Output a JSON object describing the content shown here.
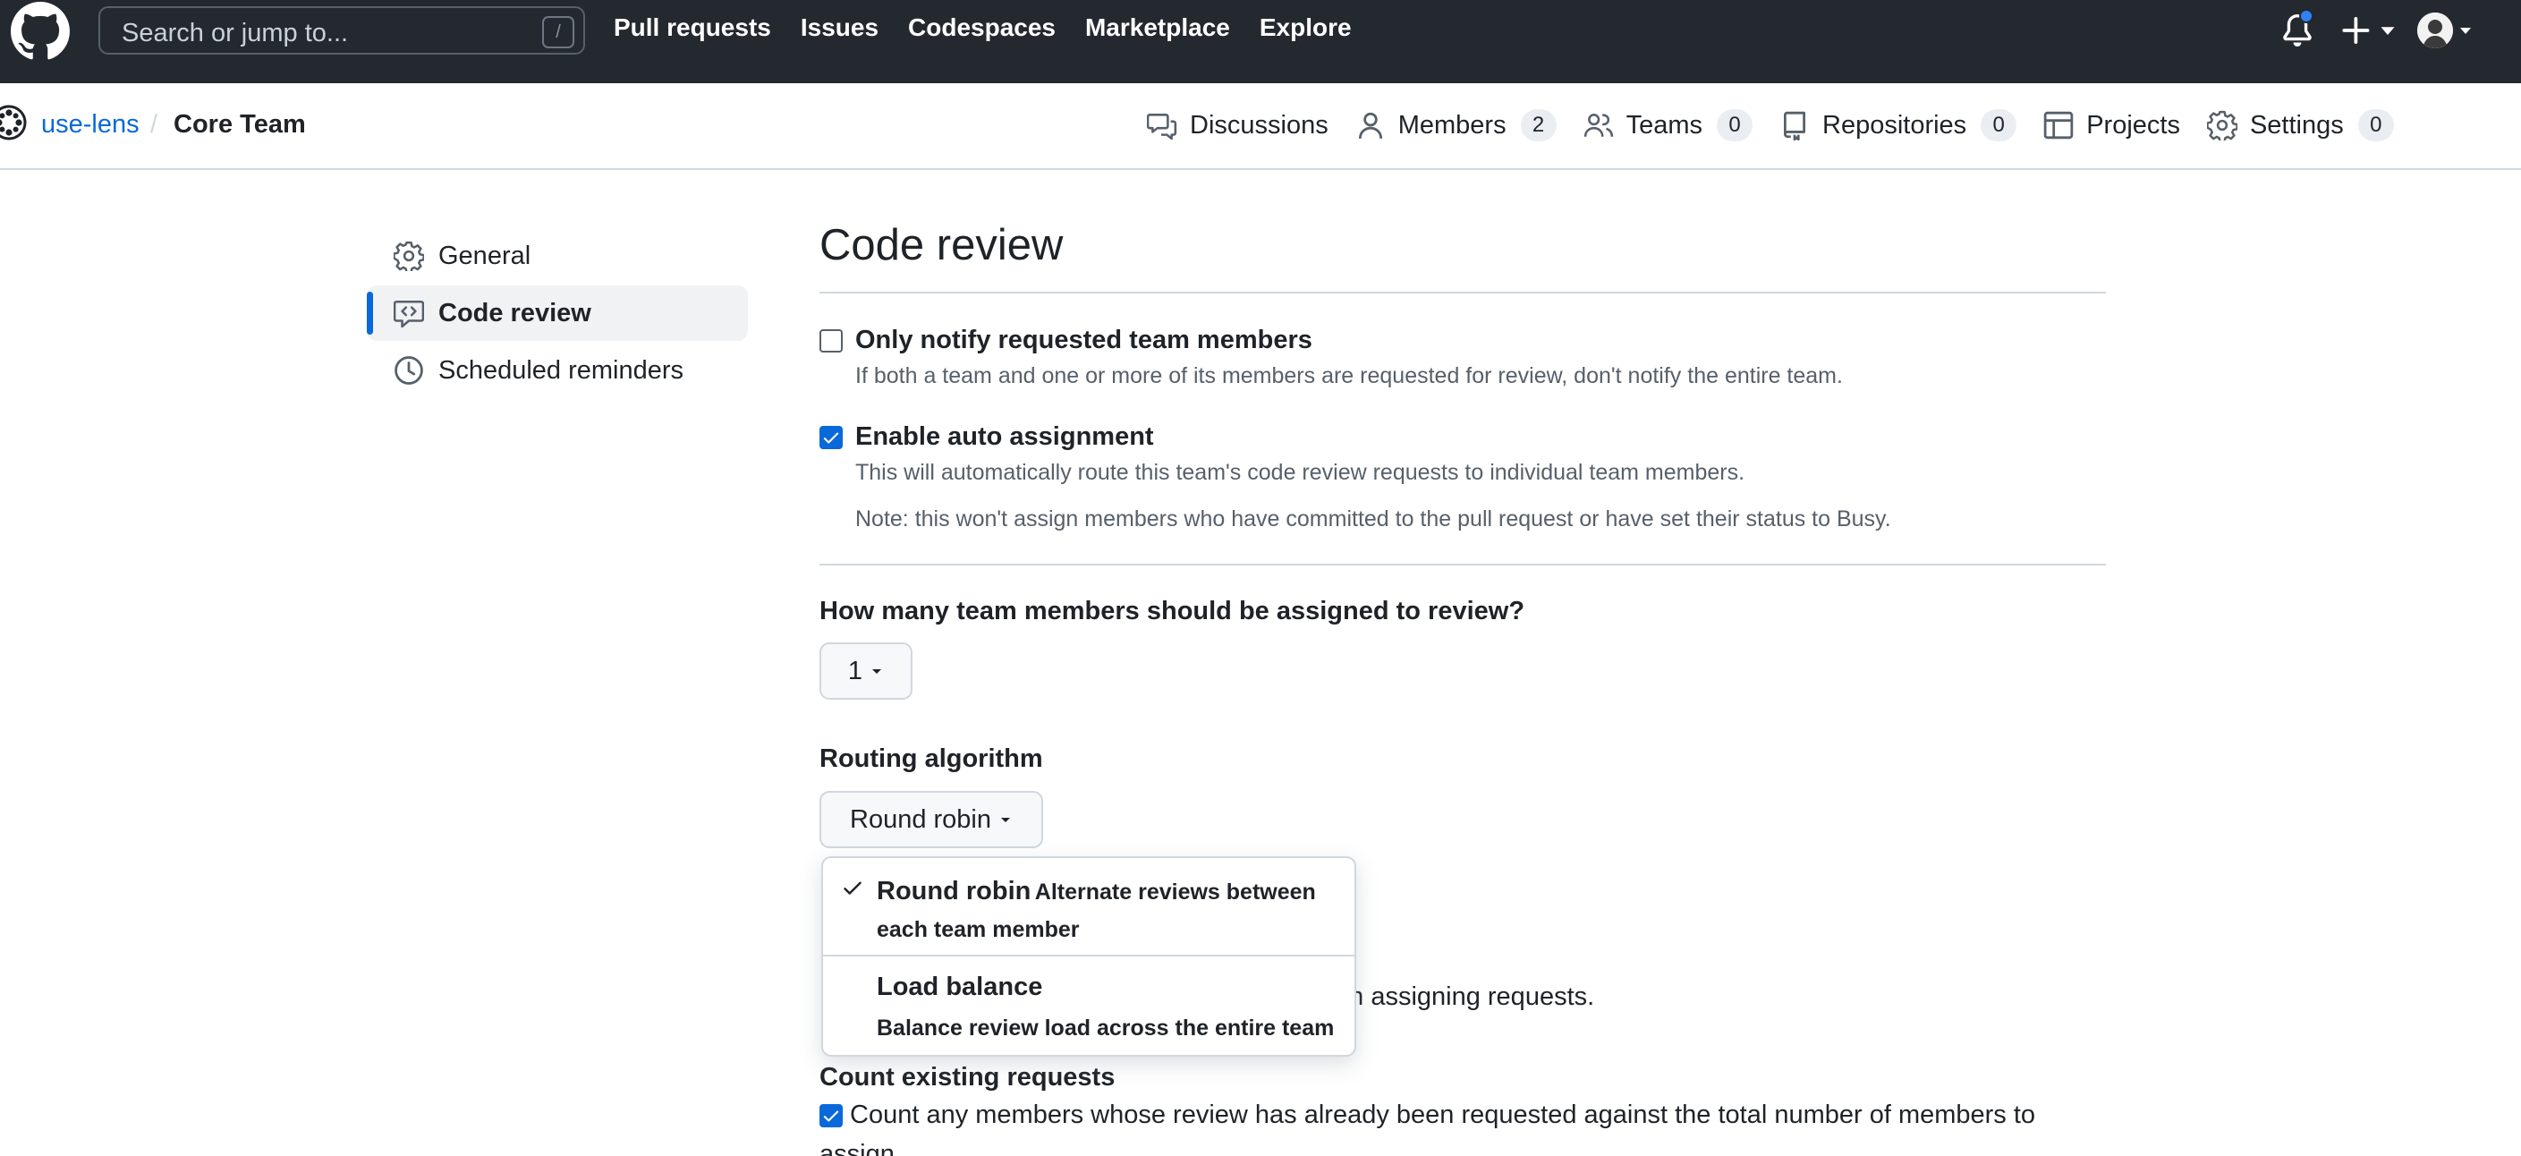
{
  "header": {
    "search_placeholder": "Search or jump to...",
    "search_shortcut": "/",
    "nav": [
      {
        "label": "Pull requests"
      },
      {
        "label": "Issues"
      },
      {
        "label": "Codespaces"
      },
      {
        "label": "Marketplace"
      },
      {
        "label": "Explore"
      }
    ],
    "notification_indicator_color": "#2f81f7"
  },
  "breadcrumb": {
    "org": "use-lens",
    "separator": "/",
    "team": "Core Team"
  },
  "team_tabs": [
    {
      "label": "Discussions",
      "icon": "discussions-icon"
    },
    {
      "label": "Members",
      "count": "2",
      "icon": "person-icon"
    },
    {
      "label": "Teams",
      "count": "0",
      "icon": "people-icon"
    },
    {
      "label": "Repositories",
      "count": "0",
      "icon": "repo-icon"
    },
    {
      "label": "Projects",
      "icon": "table-icon"
    },
    {
      "label": "Settings",
      "count": "0",
      "icon": "gear-icon"
    }
  ],
  "sidebar": {
    "items": [
      {
        "label": "General",
        "icon": "gear-icon"
      },
      {
        "label": "Code review",
        "icon": "code-review-icon",
        "active": true
      },
      {
        "label": "Scheduled reminders",
        "icon": "clock-icon"
      }
    ]
  },
  "main": {
    "title": "Code review",
    "only_notify": {
      "checked": false,
      "title": "Only notify requested team members",
      "desc": "If both a team and one or more of its members are requested for review, don't notify the entire team."
    },
    "auto_assign": {
      "checked": true,
      "title": "Enable auto assignment",
      "desc": "This will automatically route this team's code review requests to individual team members.",
      "note": "Note: this won't assign members who have committed to the pull request or have set their status to Busy."
    },
    "members_count": {
      "label": "How many team members should be assigned to review?",
      "value": "1"
    },
    "routing": {
      "label": "Routing algorithm",
      "value": "Round robin",
      "menu": [
        {
          "title": "Round robin",
          "desc": "Alternate reviews between each team member",
          "selected": true
        },
        {
          "title": "Load balance",
          "desc": "Balance review load across the entire team",
          "selected": false
        }
      ]
    },
    "obscured_text": "en assigning requests.",
    "count_existing": {
      "label": "Count existing requests",
      "checked": true,
      "desc": "Count any members whose review has already been requested against the total number of members to",
      "desc_cont": "assign."
    }
  },
  "colors": {
    "header_bg": "#24292f",
    "link": "#0969da",
    "accent": "#0969da",
    "border": "#d0d7de",
    "muted_text": "#57606a"
  }
}
